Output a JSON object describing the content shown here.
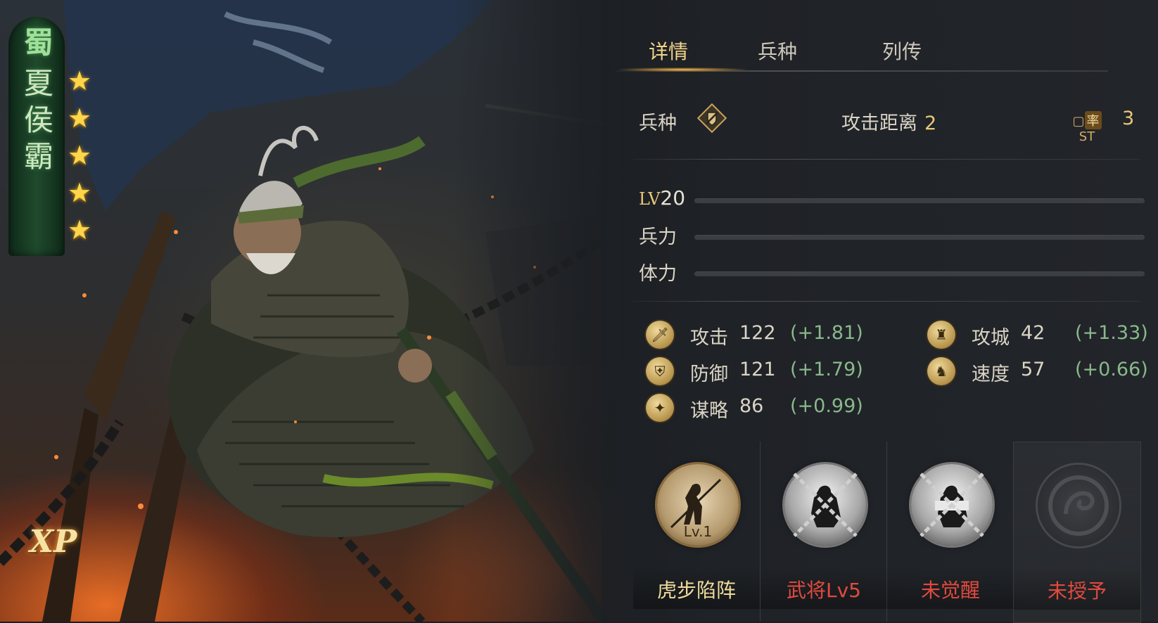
{
  "hero": {
    "faction": "蜀",
    "name": "夏侯霸",
    "stars": 5,
    "badge": "XP"
  },
  "tabs": [
    {
      "label": "详情",
      "active": true
    },
    {
      "label": "兵种",
      "active": false
    },
    {
      "label": "列传",
      "active": false
    }
  ],
  "info": {
    "unit_label": "兵种",
    "unit_icon": "shield-sword-icon",
    "range_label": "攻击距离",
    "range_value": "2",
    "cost_icon_text": "率",
    "cost_value": "3"
  },
  "bars": {
    "level_prefix": "LV",
    "level_value": "20",
    "troops_label": "兵力",
    "stamina_label": "体力"
  },
  "stats": [
    {
      "icon": "sword-icon",
      "name": "攻击",
      "value": "122",
      "bonus": "(+1.81)"
    },
    {
      "icon": "shield-icon",
      "name": "防御",
      "value": "121",
      "bonus": "(+1.79)"
    },
    {
      "icon": "strategy-icon",
      "name": "谋略",
      "value": "86",
      "bonus": "(+0.99)"
    },
    {
      "icon": "castle-icon",
      "name": "攻城",
      "value": "42",
      "bonus": "(+1.33)"
    },
    {
      "icon": "horse-icon",
      "name": "速度",
      "value": "57",
      "bonus": "(+0.66)"
    }
  ],
  "skills": [
    {
      "name": "虎步陷阵",
      "level": "Lv.1",
      "state": "learned"
    },
    {
      "name": "武将Lv5",
      "level": "",
      "state": "locked-level"
    },
    {
      "name": "未觉醒",
      "level": "",
      "state": "locked-awaken"
    },
    {
      "name": "未授予",
      "level": "",
      "state": "empty"
    }
  ],
  "colors": {
    "accent_gold": "#f3d48a",
    "bonus_green": "#88b98b",
    "locked_red": "#e24a3e",
    "faction_green": "#1f4a2c"
  }
}
